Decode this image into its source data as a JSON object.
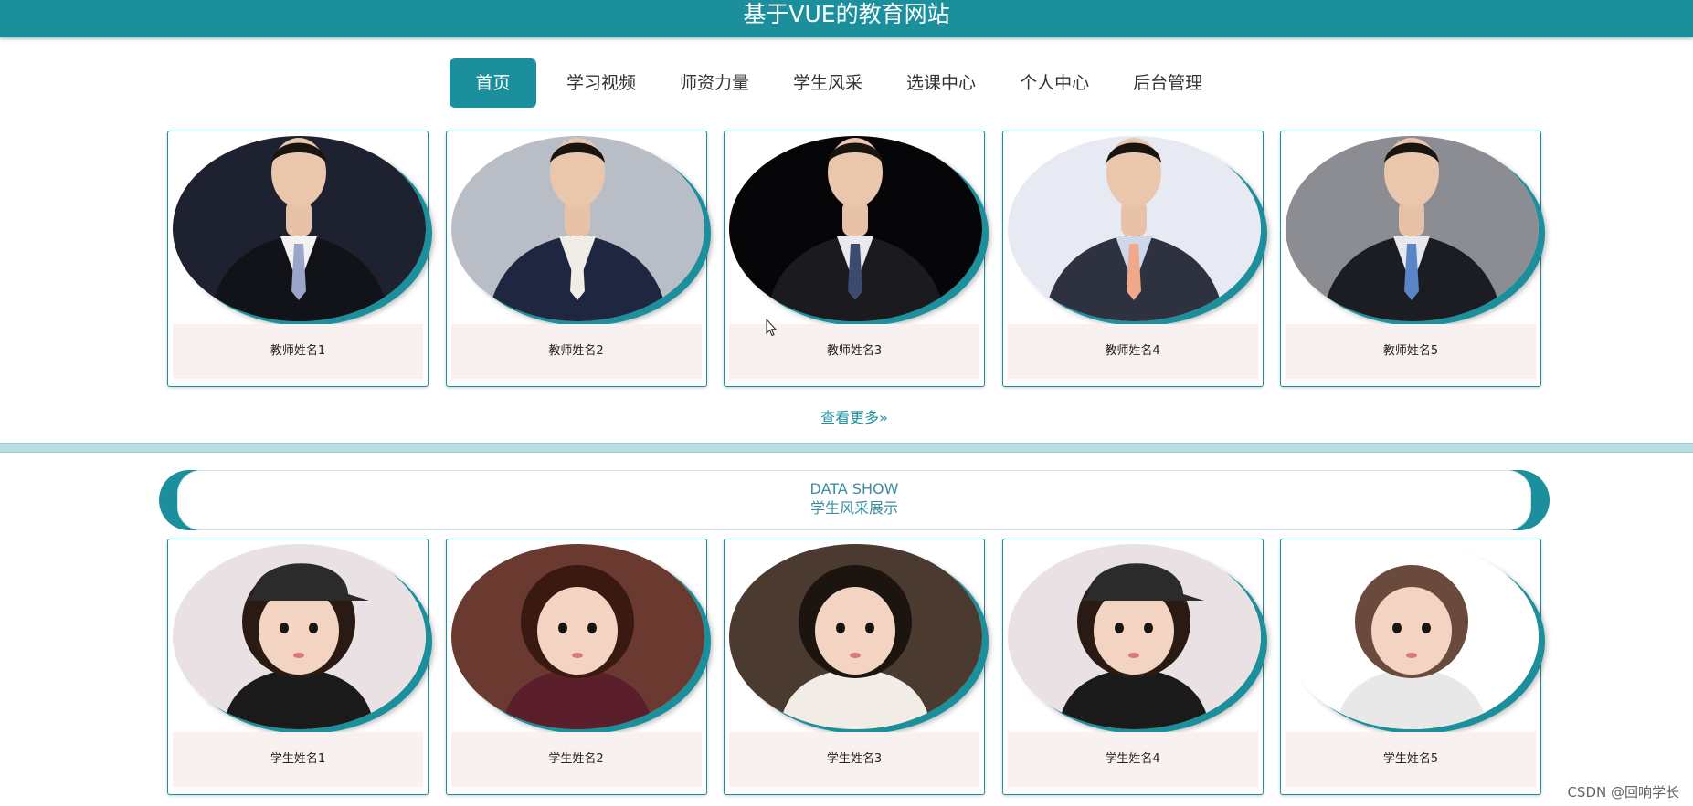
{
  "header": {
    "title": "基于VUE的教育网站"
  },
  "nav": {
    "items": [
      {
        "label": "首页",
        "active": true
      },
      {
        "label": "学习视频"
      },
      {
        "label": "师资力量"
      },
      {
        "label": "学生风采"
      },
      {
        "label": "选课中心"
      },
      {
        "label": "个人中心"
      },
      {
        "label": "后台管理"
      }
    ]
  },
  "teachers": [
    {
      "name": "教师姓名1",
      "bg": "#1e2130",
      "suit": "#111318",
      "shirt": "#f2f2f2",
      "tie": "#9aa5c9"
    },
    {
      "name": "教师姓名2",
      "bg": "#b9bec6",
      "suit": "#1f2740",
      "shirt": "#f0ece6",
      "tie": "#f0ece6"
    },
    {
      "name": "教师姓名3",
      "bg": "#060608",
      "suit": "#1a1a1f",
      "shirt": "#e8eaf0",
      "tie": "#3b4a6e"
    },
    {
      "name": "教师姓名4",
      "bg": "#e7eaf3",
      "suit": "#2d3140",
      "shirt": "#cfd8ea",
      "tie": "#f0a98a"
    },
    {
      "name": "教师姓名5",
      "bg": "#8c8d93",
      "suit": "#1c1d22",
      "shirt": "#e6e8ee",
      "tie": "#5a86c8"
    }
  ],
  "more_link": "查看更多»",
  "banner": {
    "en": "DATA SHOW",
    "cn": "学生风采展示"
  },
  "students": [
    {
      "name": "学生姓名1",
      "bg": "#e9e1e3",
      "top": "#1a1a1a",
      "hair": "#2a1a14",
      "hat": "#2b2b2b"
    },
    {
      "name": "学生姓名2",
      "bg": "#6a3a30",
      "top": "#5a1f2a",
      "hair": "#3a1a10",
      "hat": ""
    },
    {
      "name": "学生姓名3",
      "bg": "#4a3a30",
      "top": "#f1ede6",
      "hair": "#1c140f",
      "hat": ""
    },
    {
      "name": "学生姓名4",
      "bg": "#e9e1e3",
      "top": "#1a1a1a",
      "hair": "#2a1a14",
      "hat": "#2b2b2b"
    },
    {
      "name": "学生姓名5",
      "bg": "#ffffff",
      "top": "#e8e8e8",
      "hair": "#6b4a3e",
      "hat": ""
    }
  ],
  "watermark": "CSDN @回响学长"
}
